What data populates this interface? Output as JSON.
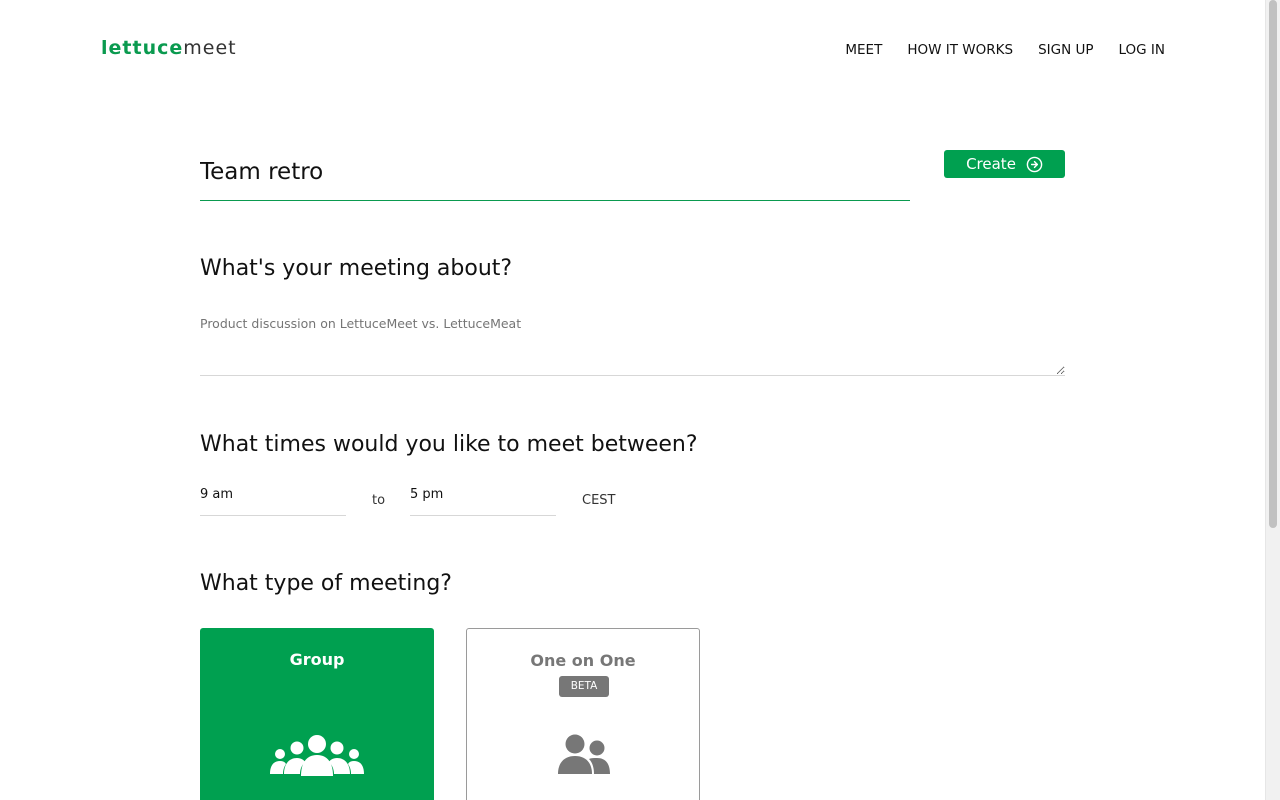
{
  "header": {
    "logo_part1": "lettuce",
    "logo_part2": "meet",
    "nav": [
      "MEET",
      "HOW IT WORKS",
      "SIGN UP",
      "LOG IN"
    ]
  },
  "form": {
    "title_value": "Team retro",
    "create_label": "Create",
    "about_heading": "What's your meeting about?",
    "description_placeholder": "Product discussion on LettuceMeet vs. LettuceMeat",
    "times_heading": "What times would you like to meet between?",
    "start_time": "9 am",
    "to_label": "to",
    "end_time": "5 pm",
    "timezone": "CEST",
    "type_heading": "What type of meeting?",
    "types": [
      {
        "label": "Group",
        "selected": true,
        "icon": "group-icon"
      },
      {
        "label": "One on One",
        "badge": "BETA",
        "selected": false,
        "icon": "two-users-icon"
      }
    ]
  },
  "colors": {
    "brand_green": "#00a050",
    "logo_green": "#0a9a4f",
    "muted_gray": "#777777"
  }
}
